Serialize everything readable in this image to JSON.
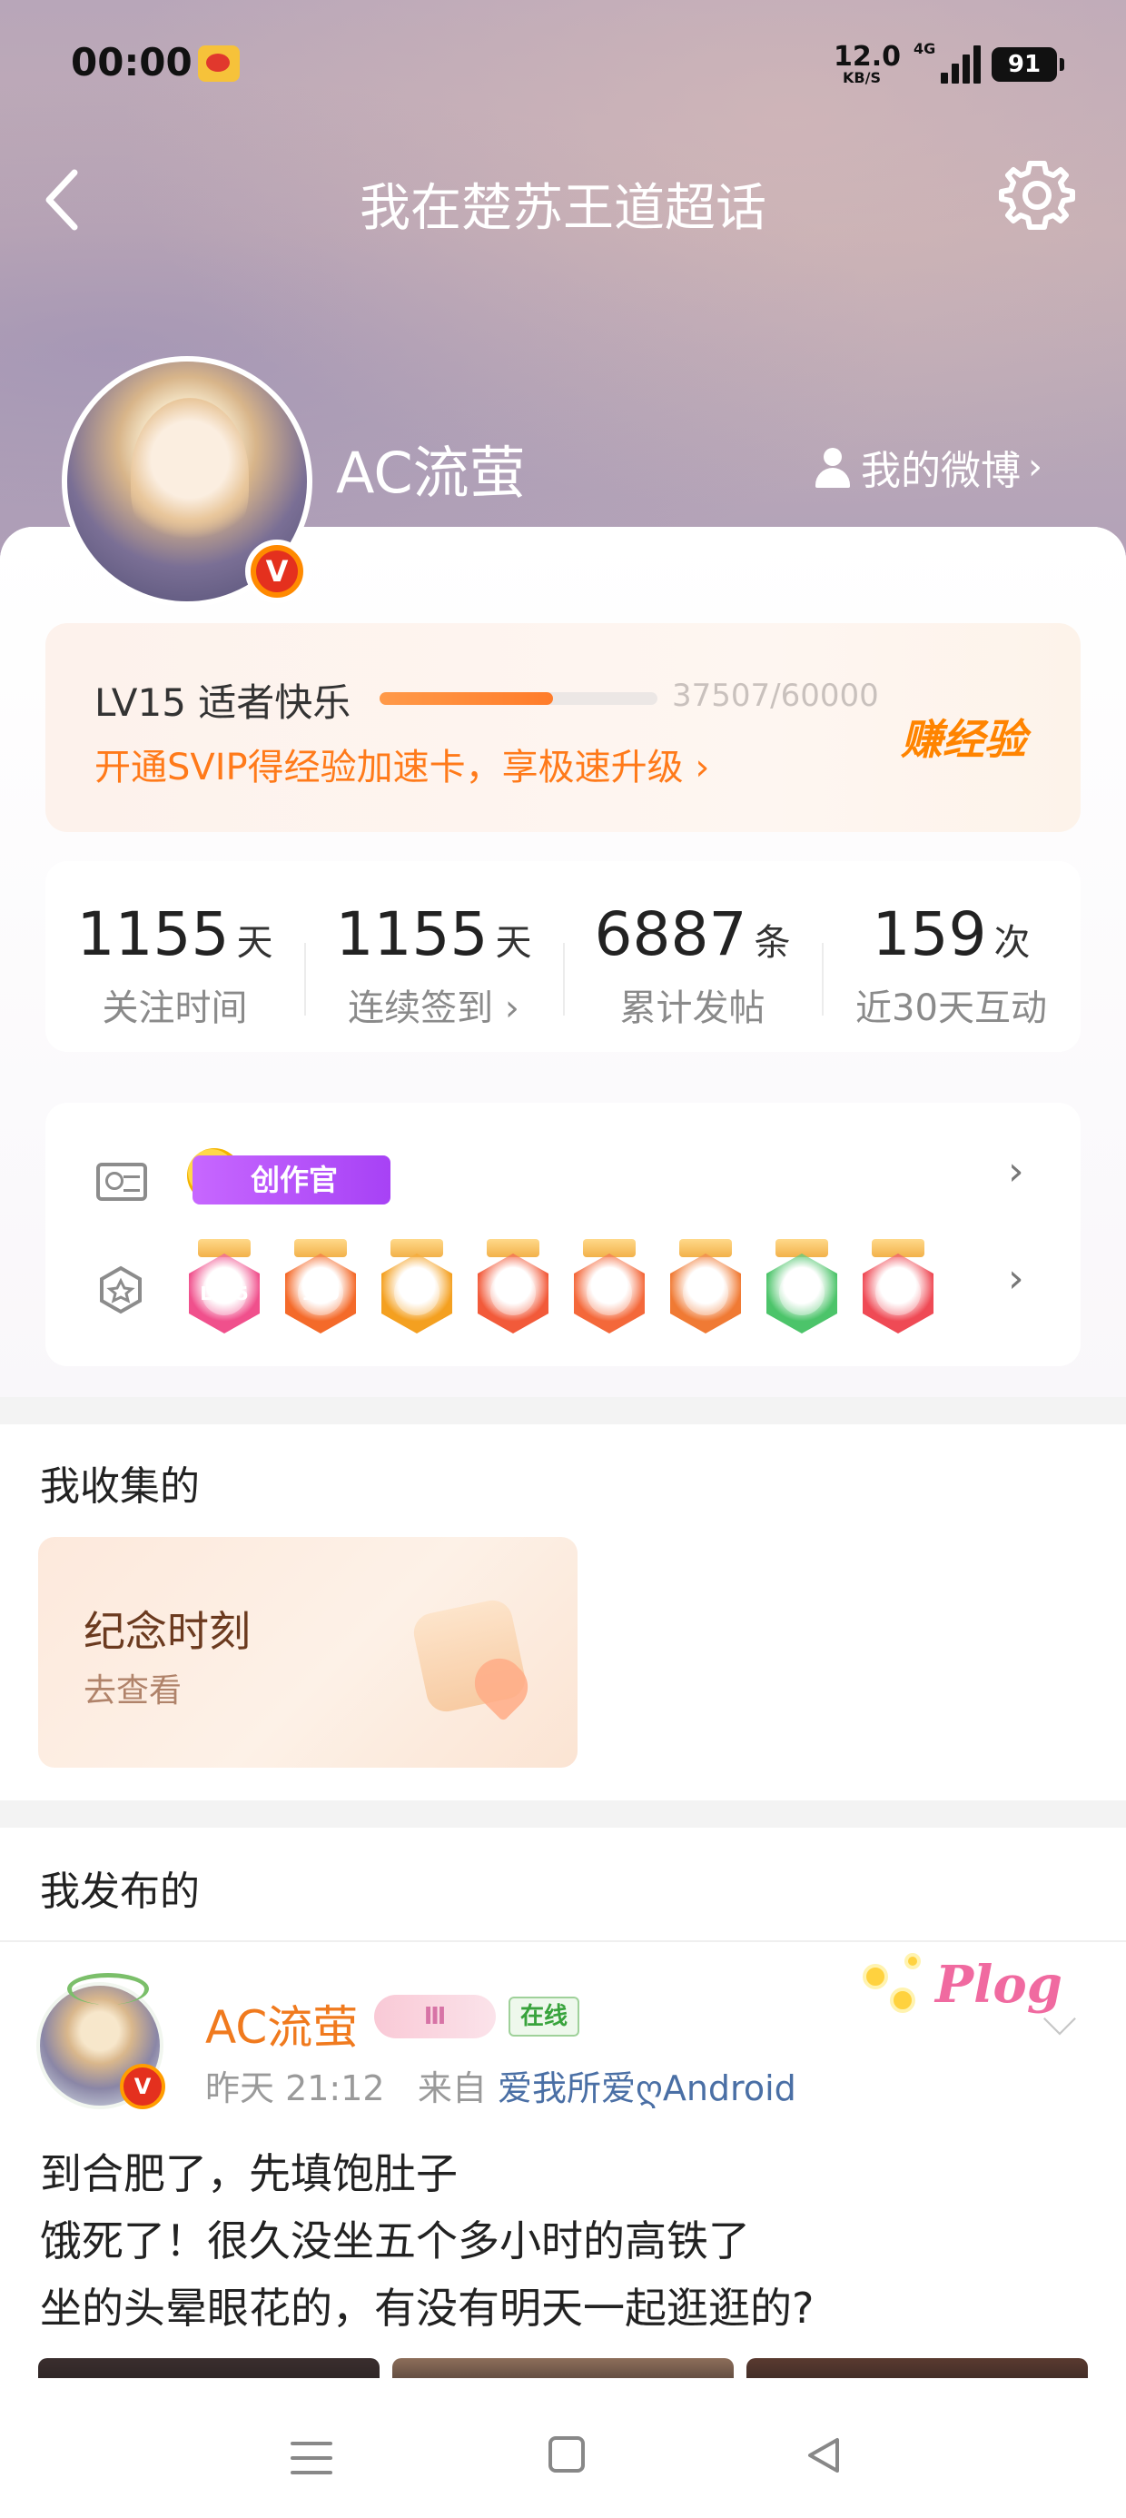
{
  "status_bar": {
    "time": "00:00",
    "app_icon": "weibo-icon",
    "net_speed": "12.0",
    "net_speed_unit": "KB/S",
    "network": "4G",
    "battery": "91"
  },
  "header": {
    "title": "我在楚苏王道超话",
    "back_icon": "chevron-left-icon",
    "settings_icon": "gear-icon"
  },
  "profile": {
    "username": "AC流萤",
    "my_weibo_label": "我的微博",
    "verified_badge": "V"
  },
  "level": {
    "title": "LV15 适者快乐",
    "progress_text": "37507/60000",
    "progress_fraction": 0.625,
    "promo": "开通SVIP得经验加速卡，享极速升级",
    "earn_exp": "赚经验"
  },
  "stats": [
    {
      "value": "1155",
      "unit": "天",
      "label": "关注时间"
    },
    {
      "value": "1155",
      "unit": "天",
      "label": "连续签到"
    },
    {
      "value": "6887",
      "unit": "条",
      "label": "累计发帖"
    },
    {
      "value": "159",
      "unit": "次",
      "label": "近30天互动"
    }
  ],
  "badges": {
    "creator_tag": "创作官",
    "medals": [
      {
        "name": "lv15-medal",
        "text": "LV15",
        "color": "#f0508c"
      },
      {
        "name": "100-days-medal",
        "text": "100",
        "color": "#f46a2a"
      },
      {
        "name": "crown-medal",
        "text": "",
        "color": "#f4a020"
      },
      {
        "name": "cat-medal-1",
        "text": "",
        "color": "#f25a3a"
      },
      {
        "name": "cat-medal-2",
        "text": "",
        "color": "#f4683a"
      },
      {
        "name": "cat-medal-3",
        "text": "",
        "color": "#f07a34"
      },
      {
        "name": "hand-medal",
        "text": "",
        "color": "#4cc46a"
      },
      {
        "name": "trophy-medal",
        "text": "",
        "color": "#ef4a55"
      }
    ]
  },
  "collection": {
    "section_title": "我收集的",
    "memorial_title": "纪念时刻",
    "memorial_sub": "去查看"
  },
  "posts_section": {
    "section_title": "我发布的"
  },
  "post": {
    "author": "AC流萤",
    "vip_tag": "Ⅲ",
    "online_tag": "在线",
    "sticker_text": "Plog",
    "time": "昨天 21:12",
    "source_prefix": "来自",
    "source": "爱我所爱ღAndroid",
    "lines": [
      "到合肥了，先填饱肚子",
      "饿死了！很久没坐五个多小时的高铁了",
      "坐的头晕眼花的，有没有明天一起逛逛的?"
    ],
    "image_colors": [
      "#3a2e2e",
      "#8d6e5a",
      "#5a3a30"
    ]
  },
  "nav": {
    "menu_icon": "menu-icon",
    "home_icon": "home-square-icon",
    "back_icon": "back-triangle-icon"
  }
}
